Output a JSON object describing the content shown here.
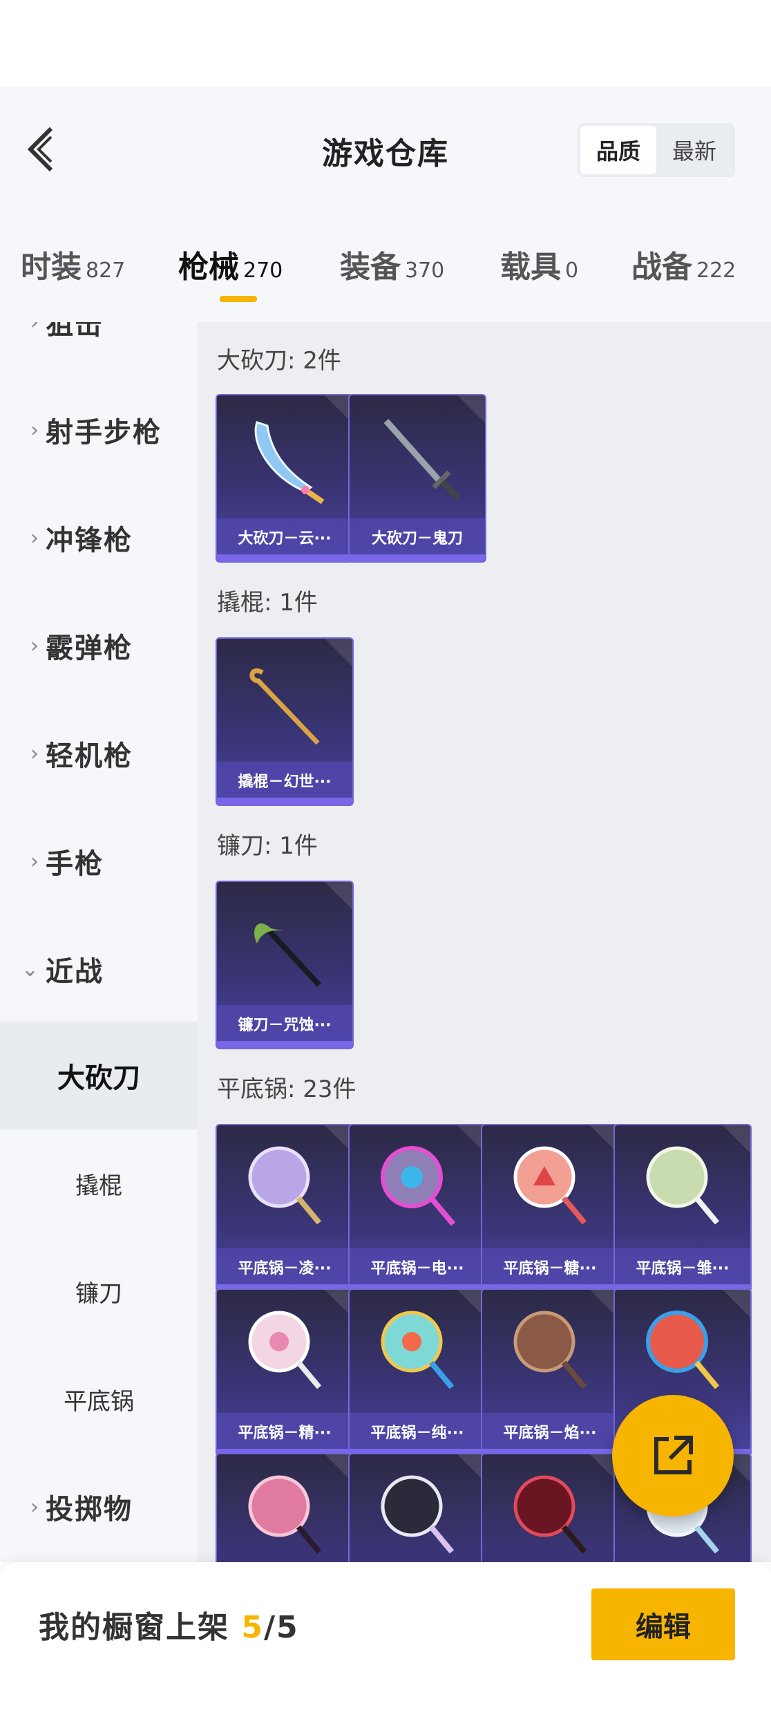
{
  "header": {
    "title": "游戏仓库",
    "sort": {
      "quality": "品质",
      "newest": "最新",
      "selected": "quality"
    }
  },
  "tabs": [
    {
      "label": "时装",
      "count": "827"
    },
    {
      "label": "枪械",
      "count": "270",
      "active": true
    },
    {
      "label": "装备",
      "count": "370"
    },
    {
      "label": "载具",
      "count": "0"
    },
    {
      "label": "战备",
      "count": "222"
    }
  ],
  "sidebar": {
    "partial_top": "狙击",
    "categories": [
      {
        "label": "射手步枪",
        "expanded": false
      },
      {
        "label": "冲锋枪",
        "expanded": false
      },
      {
        "label": "霰弹枪",
        "expanded": false
      },
      {
        "label": "轻机枪",
        "expanded": false
      },
      {
        "label": "手枪",
        "expanded": false
      },
      {
        "label": "近战",
        "expanded": true
      }
    ],
    "subs": [
      {
        "label": "大砍刀",
        "active": true
      },
      {
        "label": "撬棍"
      },
      {
        "label": "镰刀"
      },
      {
        "label": "平底锅"
      }
    ],
    "last": {
      "label": "投掷物",
      "expanded": false
    }
  },
  "sections": [
    {
      "title": "大砍刀: 2件",
      "items": [
        "大砍刀－云···",
        "大砍刀－鬼刀"
      ]
    },
    {
      "title": "撬棍: 1件",
      "items": [
        "撬棍－幻世···"
      ]
    },
    {
      "title": "镰刀: 1件",
      "items": [
        "镰刀－咒蚀···"
      ]
    },
    {
      "title": "平底锅: 23件",
      "items": [
        "平底锅－凌···",
        "平底锅－电···",
        "平底锅－糖···",
        "平底锅－雏···",
        "平底锅－精···",
        "平底锅－纯···",
        "平底锅－焰···"
      ]
    }
  ],
  "bottom": {
    "prefix": "我的橱窗上架 ",
    "current": "5",
    "total": "/5",
    "edit": "编辑"
  },
  "colors": {
    "accent": "#f7b500",
    "card": "#3a3577"
  }
}
